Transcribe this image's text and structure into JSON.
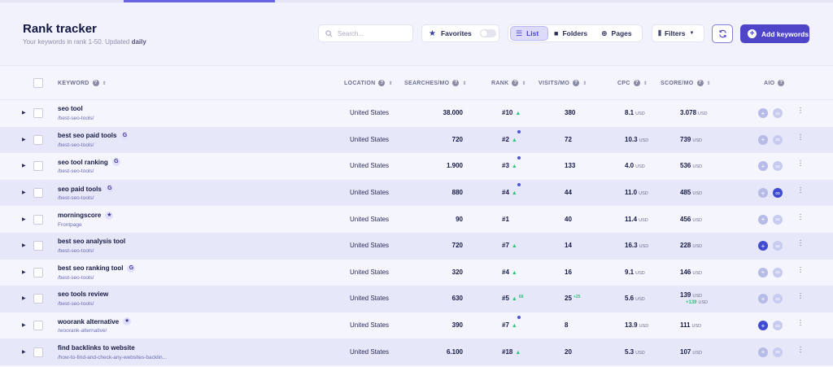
{
  "header": {
    "title": "Rank tracker",
    "subtitle_prefix": "Your keywords in rank 1-50. Updated",
    "subtitle_bold": "daily"
  },
  "toolbar": {
    "search_placeholder": "Search...",
    "favorites_label": "Favorites",
    "views": [
      "List",
      "Folders",
      "Pages"
    ],
    "active_view": "List",
    "filters_label": "Filters",
    "add_keywords_label": "Add keywords"
  },
  "columns": {
    "keyword": "KEYWORD",
    "location": "LOCATION",
    "searches": "SEARCHES/MO",
    "rank": "RANK",
    "visits": "VISITS/MO",
    "cpc": "CPC",
    "score": "SCORE/MO",
    "aio": "AIO"
  },
  "currency": "USD",
  "rows": [
    {
      "keyword": "seo tool",
      "url": "/best-seo-tools/",
      "badge": "",
      "location": "United States",
      "searches": "38.000",
      "rank": "#10",
      "rank_up": true,
      "rank_change": "",
      "rank_dot": false,
      "visits": "380",
      "visits_change": "",
      "cpc": "8.1",
      "score": "3.078",
      "score_change": "",
      "aio_on": false,
      "link_on": false
    },
    {
      "keyword": "best seo paid tools",
      "url": "/best-seo-tools/",
      "badge": "G",
      "location": "United States",
      "searches": "720",
      "rank": "#2",
      "rank_up": true,
      "rank_change": "",
      "rank_dot": true,
      "visits": "72",
      "visits_change": "",
      "cpc": "10.3",
      "score": "739",
      "score_change": "",
      "aio_on": false,
      "link_on": false
    },
    {
      "keyword": "seo tool ranking",
      "url": "/best-seo-tools/",
      "badge": "G",
      "location": "United States",
      "searches": "1.900",
      "rank": "#3",
      "rank_up": true,
      "rank_change": "",
      "rank_dot": true,
      "visits": "133",
      "visits_change": "",
      "cpc": "4.0",
      "score": "536",
      "score_change": "",
      "aio_on": false,
      "link_on": false
    },
    {
      "keyword": "seo paid tools",
      "url": "/best-seo-tools/",
      "badge": "G",
      "location": "United States",
      "searches": "880",
      "rank": "#4",
      "rank_up": true,
      "rank_change": "",
      "rank_dot": true,
      "visits": "44",
      "visits_change": "",
      "cpc": "11.0",
      "score": "485",
      "score_change": "",
      "aio_on": false,
      "link_on": true
    },
    {
      "keyword": "morningscore",
      "url": "Frontpage",
      "badge": "star",
      "location": "United States",
      "searches": "90",
      "rank": "#1",
      "rank_up": false,
      "rank_change": "",
      "rank_dot": false,
      "visits": "40",
      "visits_change": "",
      "cpc": "11.4",
      "score": "456",
      "score_change": "",
      "aio_on": false,
      "link_on": false
    },
    {
      "keyword": "best seo analysis tool",
      "url": "/best-seo-tools/",
      "badge": "",
      "location": "United States",
      "searches": "720",
      "rank": "#7",
      "rank_up": true,
      "rank_change": "",
      "rank_dot": false,
      "visits": "14",
      "visits_change": "",
      "cpc": "16.3",
      "score": "228",
      "score_change": "",
      "aio_on": true,
      "link_on": false
    },
    {
      "keyword": "best seo ranking tool",
      "url": "/best-seo-tools/",
      "badge": "G",
      "location": "United States",
      "searches": "320",
      "rank": "#4",
      "rank_up": true,
      "rank_change": "",
      "rank_dot": false,
      "visits": "16",
      "visits_change": "",
      "cpc": "9.1",
      "score": "146",
      "score_change": "",
      "aio_on": false,
      "link_on": false
    },
    {
      "keyword": "seo tools review",
      "url": "/best-seo-tools/",
      "badge": "",
      "location": "United States",
      "searches": "630",
      "rank": "#5",
      "rank_up": true,
      "rank_change": "68",
      "rank_dot": false,
      "visits": "25",
      "visits_change": "+25",
      "cpc": "5.6",
      "score": "139",
      "score_change": "+139",
      "aio_on": false,
      "link_on": false
    },
    {
      "keyword": "woorank alternative",
      "url": "/woorank-alternative/",
      "badge": "star",
      "location": "United States",
      "searches": "390",
      "rank": "#7",
      "rank_up": true,
      "rank_change": "",
      "rank_dot": true,
      "visits": "8",
      "visits_change": "",
      "cpc": "13.9",
      "score": "111",
      "score_change": "",
      "aio_on": true,
      "link_on": false
    },
    {
      "keyword": "find backlinks to website",
      "url": "/how-to-find-and-check-any-websites-backlin...",
      "badge": "",
      "location": "United States",
      "searches": "6.100",
      "rank": "#18",
      "rank_up": true,
      "rank_change": "",
      "rank_dot": false,
      "visits": "20",
      "visits_change": "",
      "cpc": "5.3",
      "score": "107",
      "score_change": "",
      "aio_on": false,
      "link_on": false
    }
  ]
}
